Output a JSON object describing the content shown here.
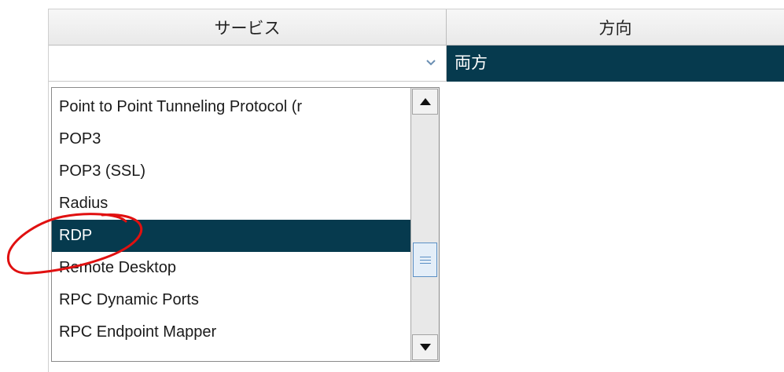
{
  "table": {
    "headers": {
      "service": "サービス",
      "direction": "方向"
    },
    "service_combo": {
      "value": ""
    },
    "direction_cell": {
      "value": "両方"
    }
  },
  "dropdown": {
    "items": [
      "Point to Point Tunneling Protocol (r",
      "POP3",
      "POP3 (SSL)",
      "Radius",
      "RDP",
      "Remote Desktop",
      "RPC Dynamic Ports",
      "RPC Endpoint Mapper"
    ],
    "selected_index": 4
  },
  "icons": {
    "combo_arrow": "chevron-down-icon",
    "scroll_up": "triangle-up-icon",
    "scroll_down": "triangle-down-icon",
    "thumb": "grip-icon"
  },
  "colors": {
    "selection": "#063a4e",
    "annotation": "#e01010",
    "thumb_border": "#5b8fc4"
  }
}
